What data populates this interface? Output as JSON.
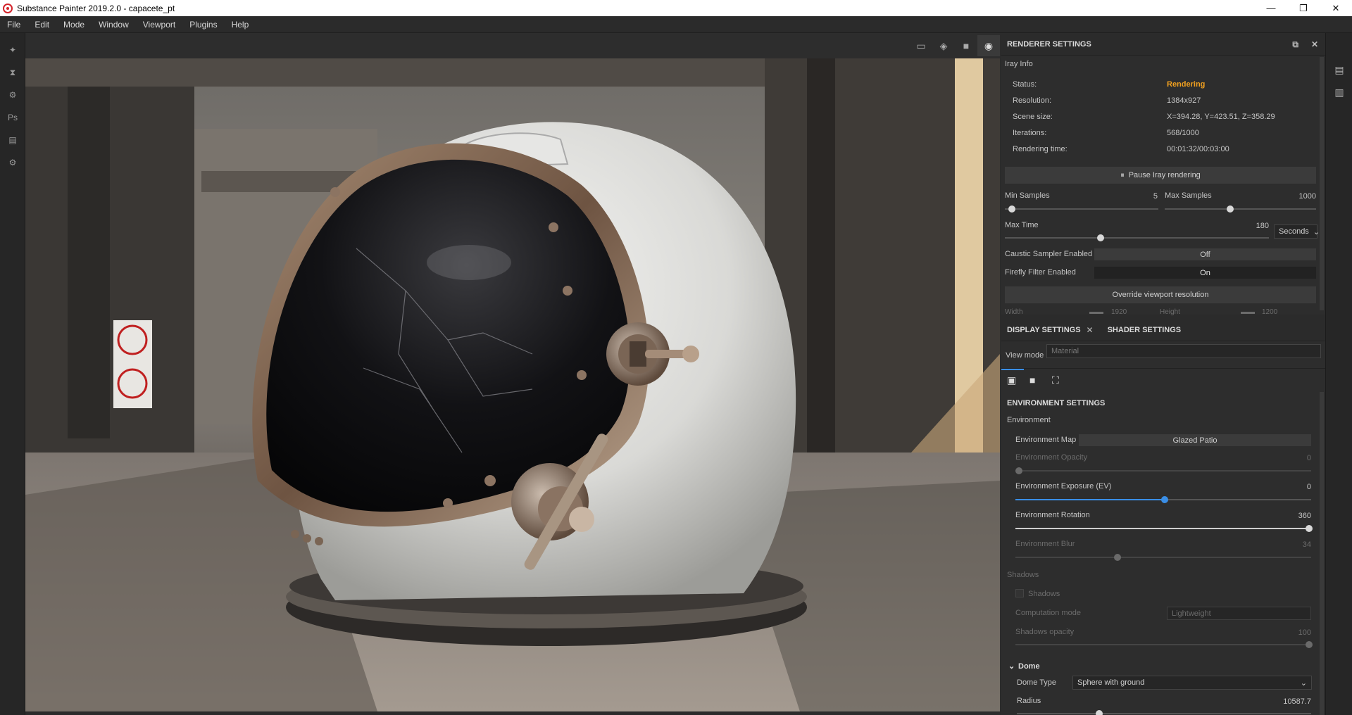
{
  "window": {
    "title": "Substance Painter 2019.2.0 - capacete_pt",
    "minimize": "—",
    "maximize": "❐",
    "close": "✕"
  },
  "menu": [
    "File",
    "Edit",
    "Mode",
    "Window",
    "Viewport",
    "Plugins",
    "Help"
  ],
  "renderer": {
    "title": "RENDERER SETTINGS",
    "section": "Iray Info",
    "info": [
      {
        "label": "Status:",
        "value": "Rendering"
      },
      {
        "label": "Resolution:",
        "value": "1384x927"
      },
      {
        "label": "Scene size:",
        "value": "X=394.28, Y=423.51, Z=358.29"
      },
      {
        "label": "Iterations:",
        "value": "568/1000"
      },
      {
        "label": "Rendering time:",
        "value": "00:01:32/00:03:00"
      }
    ],
    "status_color": "#f0a020",
    "pause_button": "Pause Iray rendering",
    "min_samples": {
      "label": "Min Samples",
      "value": "5"
    },
    "max_samples": {
      "label": "Max Samples",
      "value": "1000"
    },
    "max_time": {
      "label": "Max Time",
      "value": "180",
      "unit": "Seconds"
    },
    "caustic": {
      "label": "Caustic Sampler Enabled",
      "value": "Off"
    },
    "firefly": {
      "label": "Firefly Filter Enabled",
      "value": "On"
    },
    "override_button": "Override viewport resolution",
    "width_label": "Width",
    "width_value": "1920",
    "height_label": "Height",
    "height_value": "1200"
  },
  "display": {
    "tab1": "DISPLAY SETTINGS",
    "tab2": "SHADER SETTINGS",
    "view_mode_label": "View mode",
    "view_mode_value": "Material",
    "env_title": "ENVIRONMENT SETTINGS",
    "env_group": "Environment",
    "env_map_label": "Environment Map",
    "env_map_value": "Glazed Patio",
    "env_opacity_label": "Environment Opacity",
    "env_opacity_value": "0",
    "env_exposure_label": "Environment Exposure (EV)",
    "env_exposure_value": "0",
    "env_rotation_label": "Environment Rotation",
    "env_rotation_value": "360",
    "env_blur_label": "Environment Blur",
    "env_blur_value": "34",
    "shadows_group": "Shadows",
    "shadows_checkbox": "Shadows",
    "computation_label": "Computation mode",
    "computation_value": "Lightweight",
    "shadows_opacity_label": "Shadows opacity",
    "shadows_opacity_value": "100",
    "dome_group": "Dome",
    "dome_type_label": "Dome Type",
    "dome_type_value": "Sphere with ground",
    "radius_label": "Radius",
    "radius_value": "10587.7"
  }
}
